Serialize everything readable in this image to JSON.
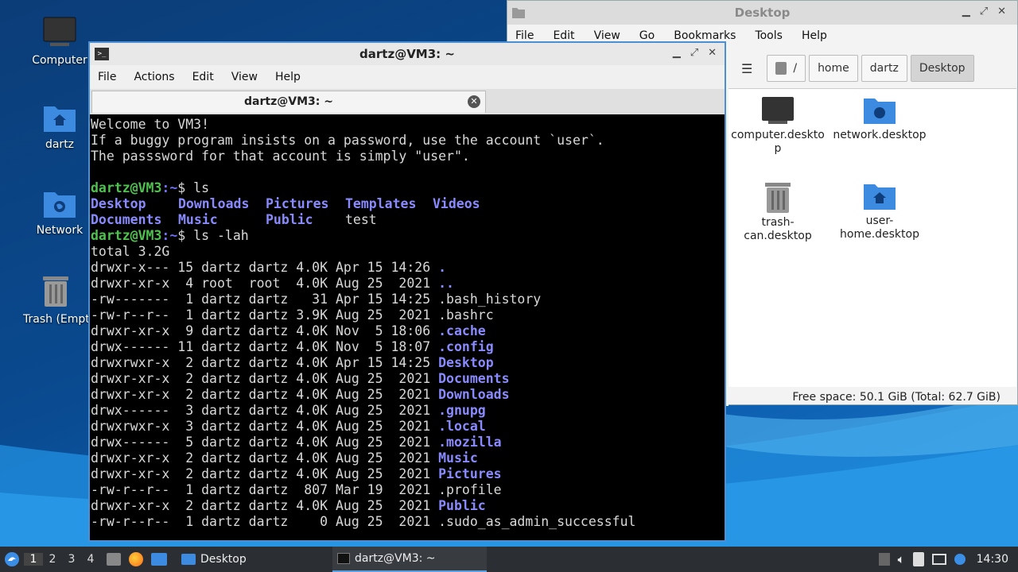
{
  "desktop": {
    "icons": [
      {
        "label": "Computer",
        "icon": "computer-icon"
      },
      {
        "label": "dartz",
        "icon": "home-folder-icon"
      },
      {
        "label": "Network",
        "icon": "network-folder-icon"
      },
      {
        "label": "Trash (Empty)",
        "icon": "trash-icon"
      }
    ]
  },
  "file_manager": {
    "title": "Desktop",
    "menu": [
      "File",
      "Edit",
      "View",
      "Go",
      "Bookmarks",
      "Tools",
      "Help"
    ],
    "breadcrumb": [
      "/",
      "home",
      "dartz",
      "Desktop"
    ],
    "files": [
      {
        "name": "computer.deskto\np",
        "icon": "computer-icon"
      },
      {
        "name": "network.desktop",
        "icon": "network-folder-icon"
      },
      {
        "name": "trash-\ncan.desktop",
        "icon": "trash-icon"
      },
      {
        "name": "user-\nhome.desktop",
        "icon": "home-folder-icon"
      }
    ],
    "status": "Free space: 50.1 GiB (Total: 62.7 GiB)"
  },
  "terminal": {
    "title": "dartz@VM3: ~",
    "menu": [
      "File",
      "Actions",
      "Edit",
      "View",
      "Help"
    ],
    "tab_label": "dartz@VM3: ~",
    "welcome": [
      "Welcome to VM3!",
      "If a buggy program insists on a password, use the account `user`.",
      "The passsword for that account is simply \"user\"."
    ],
    "prompt_user": "dartz@VM3",
    "prompt_path": ":~",
    "cmd1": "$ ls",
    "ls_dirs": [
      [
        "Desktop",
        "Downloads",
        "Pictures",
        "Templates",
        "Videos"
      ],
      [
        "Documents",
        "Music",
        "Public"
      ]
    ],
    "ls_file": "test",
    "cmd2": "$ ls -lah",
    "total": "total 3.2G",
    "rows": [
      {
        "meta": "drwxr-x--- 15 dartz dartz 4.0K Apr 15 14:26 ",
        "name": ".",
        "dir": true
      },
      {
        "meta": "drwxr-xr-x  4 root  root  4.0K Aug 25  2021 ",
        "name": "..",
        "dir": true
      },
      {
        "meta": "-rw-------  1 dartz dartz   31 Apr 15 14:25 ",
        "name": ".bash_history",
        "dir": false
      },
      {
        "meta": "-rw-r--r--  1 dartz dartz 3.9K Aug 25  2021 ",
        "name": ".bashrc",
        "dir": false
      },
      {
        "meta": "drwxr-xr-x  9 dartz dartz 4.0K Nov  5 18:06 ",
        "name": ".cache",
        "dir": true
      },
      {
        "meta": "drwx------ 11 dartz dartz 4.0K Nov  5 18:07 ",
        "name": ".config",
        "dir": true
      },
      {
        "meta": "drwxrwxr-x  2 dartz dartz 4.0K Apr 15 14:25 ",
        "name": "Desktop",
        "dir": true
      },
      {
        "meta": "drwxr-xr-x  2 dartz dartz 4.0K Aug 25  2021 ",
        "name": "Documents",
        "dir": true
      },
      {
        "meta": "drwxr-xr-x  2 dartz dartz 4.0K Aug 25  2021 ",
        "name": "Downloads",
        "dir": true
      },
      {
        "meta": "drwx------  3 dartz dartz 4.0K Aug 25  2021 ",
        "name": ".gnupg",
        "dir": true
      },
      {
        "meta": "drwxrwxr-x  3 dartz dartz 4.0K Aug 25  2021 ",
        "name": ".local",
        "dir": true
      },
      {
        "meta": "drwx------  5 dartz dartz 4.0K Aug 25  2021 ",
        "name": ".mozilla",
        "dir": true
      },
      {
        "meta": "drwxr-xr-x  2 dartz dartz 4.0K Aug 25  2021 ",
        "name": "Music",
        "dir": true
      },
      {
        "meta": "drwxr-xr-x  2 dartz dartz 4.0K Aug 25  2021 ",
        "name": "Pictures",
        "dir": true
      },
      {
        "meta": "-rw-r--r--  1 dartz dartz  807 Mar 19  2021 ",
        "name": ".profile",
        "dir": false
      },
      {
        "meta": "drwxr-xr-x  2 dartz dartz 4.0K Aug 25  2021 ",
        "name": "Public",
        "dir": true
      },
      {
        "meta": "-rw-r--r--  1 dartz dartz    0 Aug 25  2021 ",
        "name": ".sudo_as_admin_successful",
        "dir": false
      }
    ]
  },
  "taskbar": {
    "workspaces": [
      "1",
      "2",
      "3",
      "4"
    ],
    "tasks": [
      {
        "label": "Desktop",
        "icon": "folder-icon"
      },
      {
        "label": "dartz@VM3: ~",
        "icon": "terminal-icon"
      }
    ],
    "clock": "14:30"
  },
  "colors": {
    "prompt": "#4fc14f",
    "directory": "#6f6fff",
    "terminal_border": "#4c8fd4"
  }
}
